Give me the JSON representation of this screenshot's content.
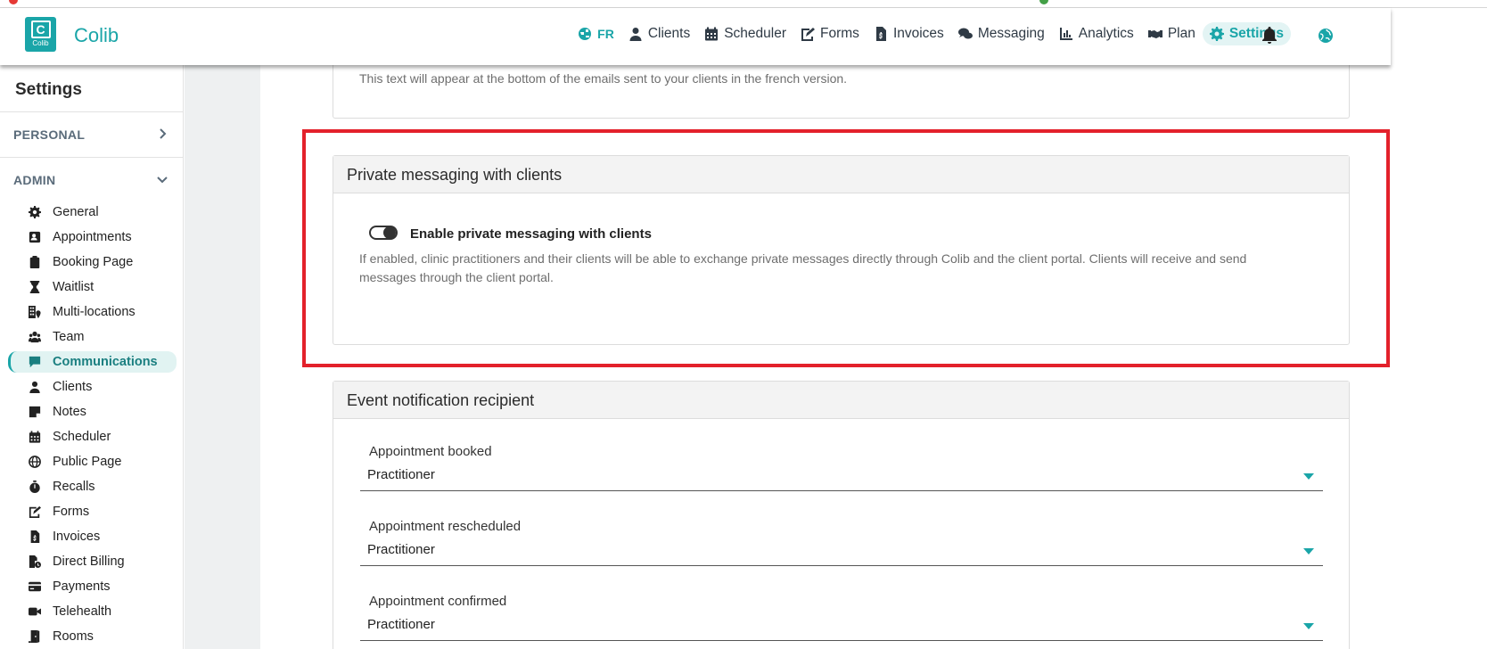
{
  "brand": {
    "name": "Colib",
    "logo_letter": "C",
    "logo_text": "Colib"
  },
  "nav": {
    "lang": "FR",
    "items": [
      {
        "label": "Clients",
        "icon": "user-icon"
      },
      {
        "label": "Scheduler",
        "icon": "calendar-icon"
      },
      {
        "label": "Forms",
        "icon": "form-icon"
      },
      {
        "label": "Invoices",
        "icon": "invoice-icon"
      },
      {
        "label": "Messaging",
        "icon": "chat-icon"
      },
      {
        "label": "Analytics",
        "icon": "chart-icon"
      },
      {
        "label": "Plan",
        "icon": "handshake-icon"
      },
      {
        "label": "Settings",
        "icon": "gear-icon",
        "active": true
      }
    ]
  },
  "sidebar": {
    "title": "Settings",
    "sections": {
      "personal": "PERSONAL",
      "admin": "ADMIN"
    },
    "items": [
      {
        "label": "General"
      },
      {
        "label": "Appointments"
      },
      {
        "label": "Booking Page"
      },
      {
        "label": "Waitlist"
      },
      {
        "label": "Multi-locations"
      },
      {
        "label": "Team"
      },
      {
        "label": "Communications",
        "active": true
      },
      {
        "label": "Clients"
      },
      {
        "label": "Notes"
      },
      {
        "label": "Scheduler"
      },
      {
        "label": "Public Page"
      },
      {
        "label": "Recalls"
      },
      {
        "label": "Forms"
      },
      {
        "label": "Invoices"
      },
      {
        "label": "Direct Billing"
      },
      {
        "label": "Payments"
      },
      {
        "label": "Telehealth"
      },
      {
        "label": "Rooms"
      }
    ]
  },
  "top_card": {
    "help": "This text will appear at the bottom of the emails sent to your clients in the french version."
  },
  "private_messaging": {
    "title": "Private messaging with clients",
    "toggle_label": "Enable private messaging with clients",
    "toggle_on": true,
    "help": "If enabled, clinic practitioners and their clients will be able to exchange private messages directly through Colib and the client portal. Clients will receive and send messages through the client portal."
  },
  "event_notification": {
    "title": "Event notification recipient",
    "fields": [
      {
        "label": "Appointment booked",
        "value": "Practitioner"
      },
      {
        "label": "Appointment rescheduled",
        "value": "Practitioner"
      },
      {
        "label": "Appointment confirmed",
        "value": "Practitioner"
      }
    ]
  },
  "colors": {
    "accent": "#1aa5a8",
    "highlight": "#e3212b"
  }
}
